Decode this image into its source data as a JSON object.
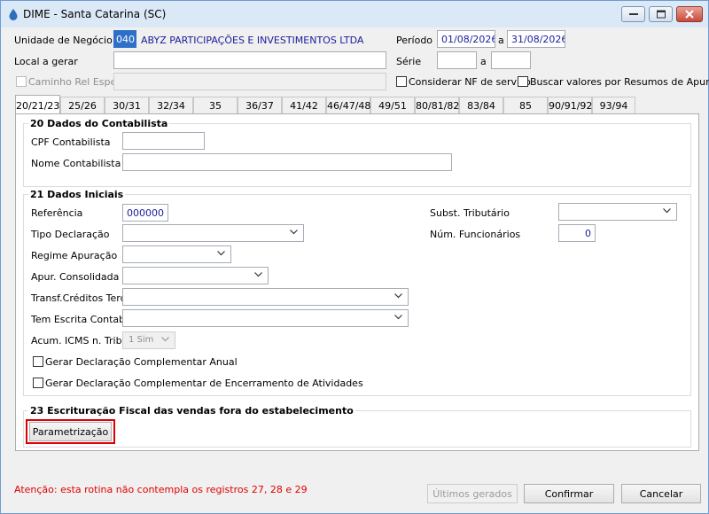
{
  "window": {
    "title": "DIME - Santa Catarina (SC)",
    "minimize_icon": "minimize-icon",
    "maximize_icon": "maximize-icon",
    "close_icon": "close-icon"
  },
  "header": {
    "unidade_label": "Unidade de Negócio",
    "unidade_code": "040",
    "unidade_name": "ABYZ PARTICIPAÇÕES E INVESTIMENTOS LTDA",
    "periodo_label": "Período",
    "periodo_from": "01/08/2026",
    "periodo_sep": "a",
    "periodo_to": "31/08/2026",
    "local_label": "Local a gerar",
    "local_value": "",
    "serie_label": "Série",
    "serie_from": "",
    "serie_sep": "a",
    "serie_to": "",
    "caminho_label": "Caminho Rel Espelho",
    "caminho_value": "",
    "considerar_nf_label": "Considerar NF de serviço",
    "buscar_valores_label": "Buscar valores por Resumos de Apuração"
  },
  "tabs": [
    "20/21/23",
    "25/26",
    "30/31",
    "32/34",
    "35",
    "36/37",
    "41/42",
    "46/47/48",
    "49/51",
    "80/81/82",
    "83/84",
    "85",
    "90/91/92",
    "93/94"
  ],
  "active_tab": "20/21/23",
  "section20": {
    "title": "20 Dados do Contabilista",
    "cpf_label": "CPF Contabilista",
    "cpf_value": "",
    "nome_label": "Nome Contabilista",
    "nome_value": ""
  },
  "section21": {
    "title": "21 Dados Iniciais",
    "referencia_label": "Referência",
    "referencia_value": "000000",
    "tipo_label": "Tipo Declaração",
    "tipo_value": "",
    "regime_label": "Regime Apuração",
    "regime_value": "",
    "apur_label": "Apur. Consolidada",
    "apur_value": "",
    "transf_label": "Transf.Créditos Terc.",
    "transf_value": "",
    "escrita_label": "Tem Escrita Contabil",
    "escrita_value": "",
    "acum_label": "Acum. ICMS n. Trib.",
    "acum_value": "1 Sim",
    "subst_label": "Subst. Tributário",
    "subst_value": "",
    "num_func_label": "Núm. Funcionários",
    "num_func_value": "0",
    "complementar_anual_label": "Gerar Declaração Complementar Anual",
    "complementar_encerramento_label": "Gerar Declaração Complementar de Encerramento de Atividades"
  },
  "section23": {
    "title": "23 Escrituração Fiscal das vendas fora do estabelecimento",
    "param_button": "Parametrização"
  },
  "footer": {
    "warning": "Atenção: esta rotina não contempla os registros 27, 28 e 29",
    "ultimos_button": "Últimos gerados",
    "confirmar_button": "Confirmar",
    "cancelar_button": "Cancelar"
  },
  "colors": {
    "warning": "#e00000",
    "highlight_border": "#e00000",
    "value_text": "#1b1b9c",
    "titlebar": "#dbe8f6"
  }
}
